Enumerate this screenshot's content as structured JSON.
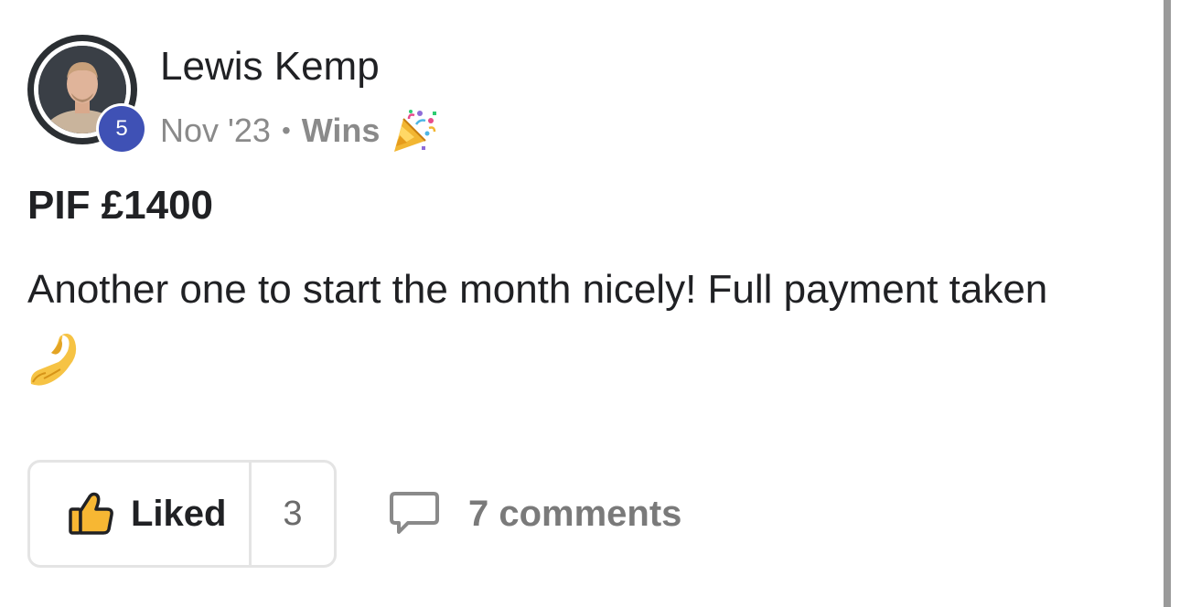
{
  "post": {
    "author": {
      "name": "Lewis Kemp",
      "level": "5",
      "avatar": "profile-photo"
    },
    "meta": {
      "date": "Nov '23",
      "separator": "•",
      "category": "Wins",
      "category_icon": "party-popper-icon"
    },
    "title": "PIF £1400",
    "body": "Another one to start the month nicely! Full payment taken",
    "body_emoji": "pinched-fingers-icon",
    "actions": {
      "like_label": "Liked",
      "like_icon": "thumbs-up-icon",
      "like_count": "3",
      "comments_label": "7 comments",
      "comments_icon": "comment-bubble-icon"
    }
  },
  "colors": {
    "level_badge": "#3f51b5",
    "meta_text": "#8a8a8a",
    "like_icon_fill": "#f7b733",
    "border": "#e4e4e4"
  }
}
